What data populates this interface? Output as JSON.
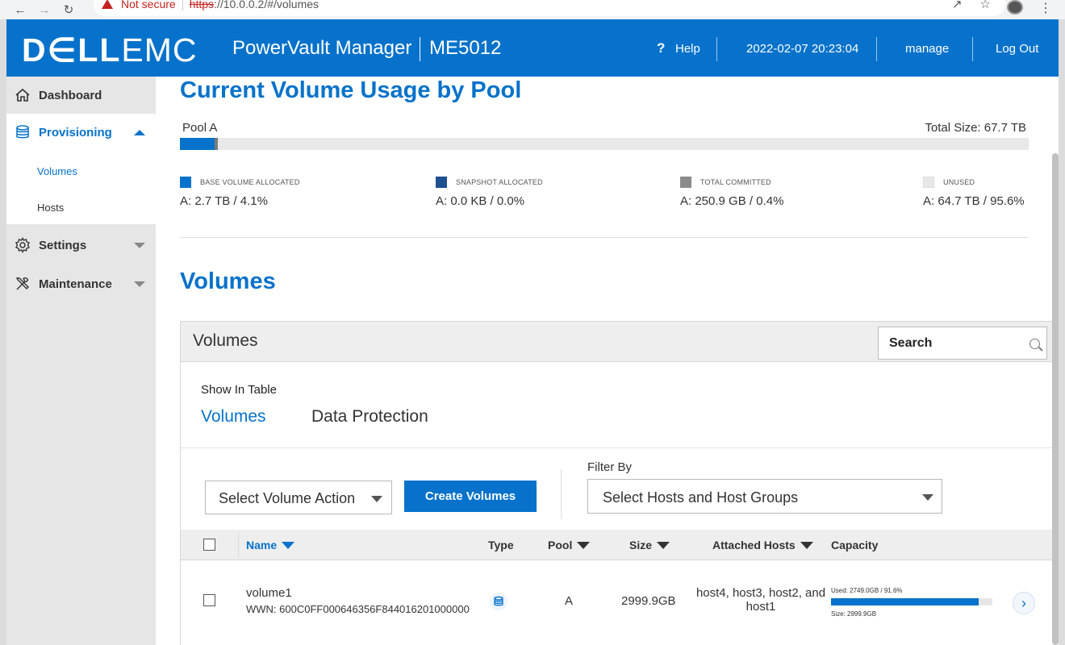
{
  "browser": {
    "security_warning": "Not secure",
    "url_scheme": "https",
    "url_rest": "://10.0.0.2/#/volumes"
  },
  "header": {
    "logo_dell": "D∈LL",
    "logo_emc": "EMC",
    "app_name": "PowerVault Manager",
    "model": "ME5012",
    "help_label": "Help",
    "datetime": "2022-02-07 20:23:04",
    "user": "manage",
    "logout_label": "Log Out"
  },
  "sidebar": {
    "items": [
      {
        "label": "Dashboard"
      },
      {
        "label": "Provisioning"
      },
      {
        "label": "Settings"
      },
      {
        "label": "Maintenance"
      }
    ],
    "sub_items": [
      {
        "label": "Volumes"
      },
      {
        "label": "Hosts"
      }
    ]
  },
  "usage": {
    "title": "Current Volume Usage by Pool",
    "pool_label": "Pool A",
    "total_size": "Total Size: 67.7 TB",
    "base_fraction": 0.041,
    "committed_fraction": 0.004,
    "legend": [
      {
        "label": "BASE VOLUME ALLOCATED",
        "value": "A: 2.7 TB / 4.1%",
        "color": "#0672cb"
      },
      {
        "label": "SNAPSHOT ALLOCATED",
        "value": "A: 0.0 KB / 0.0%",
        "color": "#1d4f91"
      },
      {
        "label": "TOTAL COMMITTED",
        "value": "A: 250.9 GB / 0.4%",
        "color": "#8a8a8a"
      },
      {
        "label": "UNUSED",
        "value": "A: 64.7 TB / 95.6%",
        "color": "#e8e8e8"
      }
    ]
  },
  "volumes": {
    "section_title": "Volumes",
    "panel_title": "Volumes",
    "search_placeholder": "Search",
    "show_in_table_label": "Show In Table",
    "tabs": [
      {
        "label": "Volumes"
      },
      {
        "label": "Data Protection"
      }
    ],
    "action_select": "Select Volume Action",
    "create_button": "Create Volumes",
    "filter_label": "Filter By",
    "filter_select": "Select Hosts and Host Groups",
    "columns": {
      "name": "Name",
      "type": "Type",
      "pool": "Pool",
      "size": "Size",
      "attached_hosts": "Attached Hosts",
      "capacity": "Capacity"
    },
    "rows": [
      {
        "name": "volume1",
        "wwn": "WWN: 600C0FF000646356F844016201000000",
        "pool": "A",
        "size": "2999.9GB",
        "attached_hosts_line1": "host4, host3, host2, and",
        "attached_hosts_line2": "host1",
        "capacity_used": "Used: 2749.0GB / 91.6%",
        "capacity_fraction": 0.916,
        "capacity_size": "Size: 2999.9GB"
      }
    ]
  }
}
